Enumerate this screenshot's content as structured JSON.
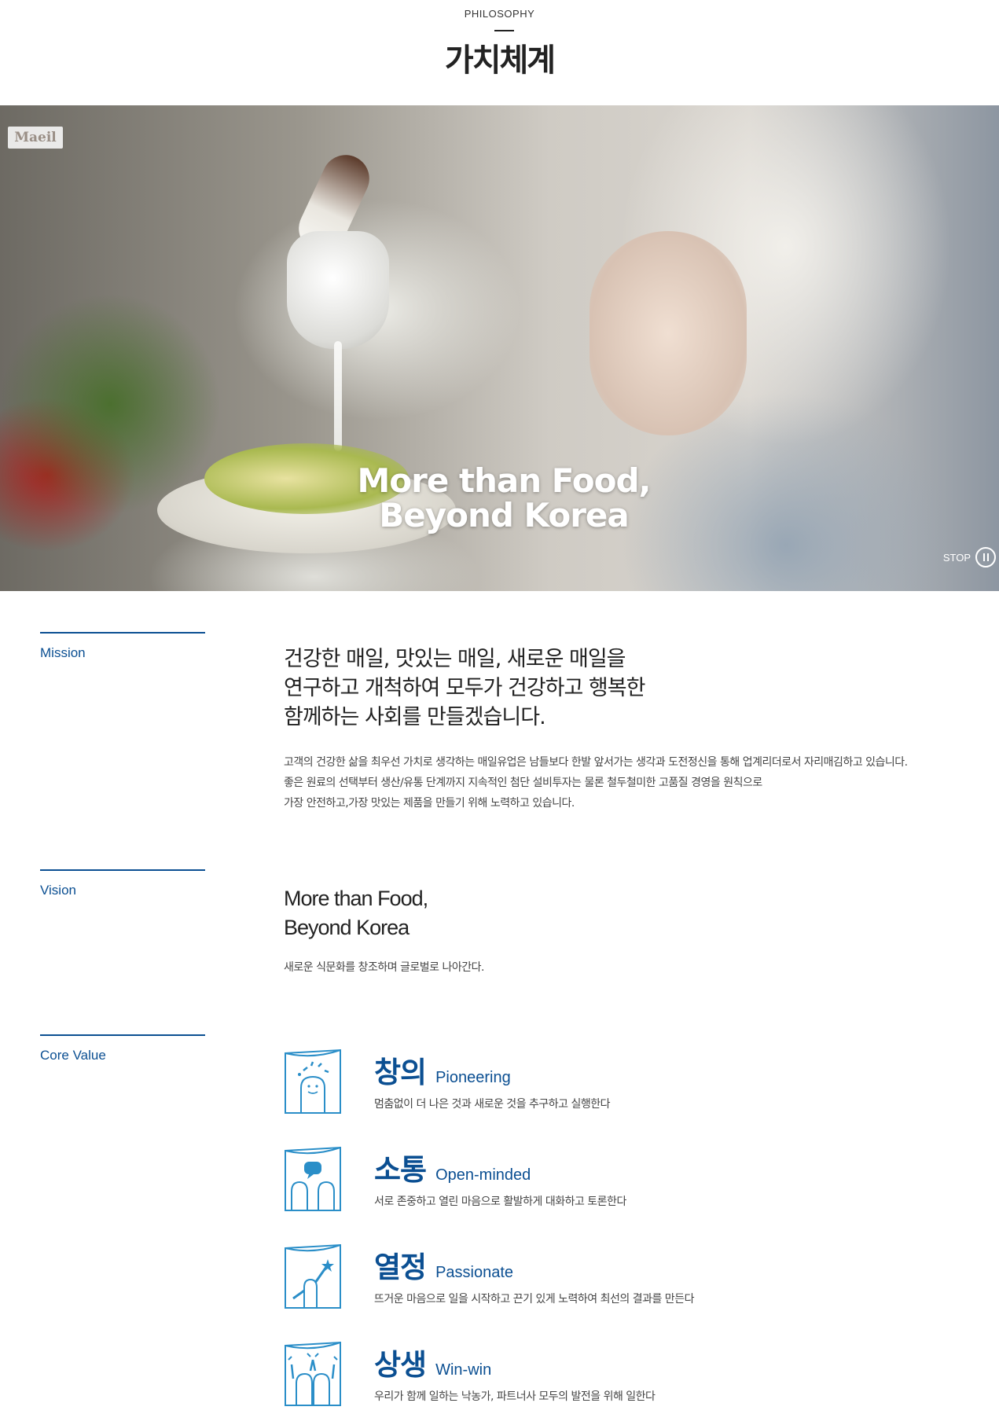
{
  "header": {
    "eyebrow": "PHILOSOPHY",
    "title": "가치체계"
  },
  "hero": {
    "logo": "Maeil",
    "slogan_line1": "More than Food,",
    "slogan_line2": "Beyond Korea",
    "stop_label": "STOP"
  },
  "mission": {
    "label": "Mission",
    "heading_line1": "건강한 매일, 맛있는 매일, 새로운 매일을",
    "heading_line2": "연구하고 개척하여 모두가 건강하고 행복한",
    "heading_line3": "함께하는 사회를 만들겠습니다.",
    "desc_line1": "고객의 건강한 삶을 최우선 가치로 생각하는 매일유업은 남들보다 한발 앞서가는 생각과 도전정신을 통해 업계리더로서 자리매김하고 있습니다.",
    "desc_line2": "좋은 원료의 선택부터 생산/유통 단계까지 지속적인 첨단 설비투자는 물론 철두철미한 고품질 경영을 원칙으로",
    "desc_line3": "가장 안전하고,가장 맛있는 제품을 만들기 위해 노력하고 있습니다."
  },
  "vision": {
    "label": "Vision",
    "heading_line1": "More than Food,",
    "heading_line2": "Beyond Korea",
    "desc": "새로운 식문화를 창조하며 글로벌로 나아간다."
  },
  "core_value": {
    "label": "Core Value",
    "accent_color": "#0b4f92",
    "items": [
      {
        "ko": "창의",
        "en": "Pioneering",
        "desc": "멈춤없이 더 나은 것과 새로운 것을 추구하고 실행한다",
        "icon": "pioneering-icon"
      },
      {
        "ko": "소통",
        "en": "Open-minded",
        "desc": "서로 존중하고 열린 마음으로 활발하게 대화하고 토론한다",
        "icon": "open-minded-icon"
      },
      {
        "ko": "열정",
        "en": "Passionate",
        "desc": "뜨거운 마음으로 일을 시작하고 끈기 있게 노력하여 최선의 결과를 만든다",
        "icon": "passionate-icon"
      },
      {
        "ko": "상생",
        "en": "Win-win",
        "desc": "우리가 함께 일하는 낙농가, 파트너사 모두의 발전을 위해 일한다",
        "icon": "win-win-icon"
      }
    ]
  }
}
